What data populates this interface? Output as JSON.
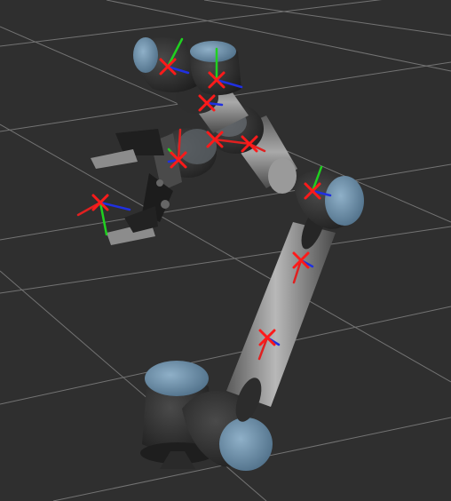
{
  "viewport": {
    "background_color": "#303030",
    "grid_color": "#8a8a8a",
    "robot_body_color": "#3b3b3b",
    "robot_cap_color": "#6f8ea8",
    "link_color": "#9a9a9a",
    "marker_color": "#ff1a1a",
    "axis_x_color": "#e02020",
    "axis_y_color": "#20d020",
    "axis_z_color": "#2030e0"
  },
  "robot": {
    "type": "robot-arm",
    "frame_markers": [
      {
        "name": "base-frame-marker"
      },
      {
        "name": "lower-link-marker"
      },
      {
        "name": "upper-link-marker"
      },
      {
        "name": "elbow-marker"
      },
      {
        "name": "wrist1-marker"
      },
      {
        "name": "wrist2-marker"
      },
      {
        "name": "wrist3-marker"
      },
      {
        "name": "shoulder-top-marker"
      },
      {
        "name": "shoulder-side-marker"
      },
      {
        "name": "gripper-frame-marker"
      },
      {
        "name": "tool-center-marker"
      }
    ]
  }
}
